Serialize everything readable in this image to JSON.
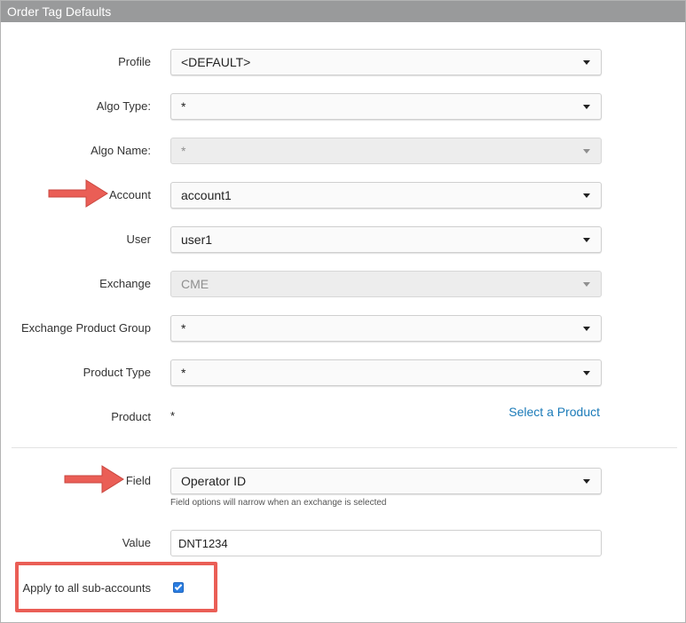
{
  "window": {
    "title": "Order Tag Defaults"
  },
  "form": {
    "profile": {
      "label": "Profile",
      "value": "<DEFAULT>"
    },
    "algo_type": {
      "label": "Algo Type:",
      "value": "*"
    },
    "algo_name": {
      "label": "Algo Name:",
      "value": "*"
    },
    "account": {
      "label": "Account",
      "value": "account1"
    },
    "user": {
      "label": "User",
      "value": "user1"
    },
    "exchange": {
      "label": "Exchange",
      "value": "CME"
    },
    "exchange_product_group": {
      "label": "Exchange Product Group",
      "value": "*"
    },
    "product_type": {
      "label": "Product Type",
      "value": "*"
    },
    "product": {
      "label": "Product",
      "value": "*",
      "link": "Select a Product"
    },
    "field": {
      "label": "Field",
      "value": "Operator ID",
      "hint": "Field options will narrow when an exchange is selected"
    },
    "value": {
      "label": "Value",
      "value": "DNT1234"
    },
    "apply_sub_accounts": {
      "label": "Apply to all sub-accounts",
      "checked": true
    }
  },
  "colors": {
    "titlebar": "#999a9b",
    "link": "#1a7ab8",
    "annotation": "#ea5e56",
    "checkbox": "#2a7de1"
  },
  "icons": [
    "caret-down-icon",
    "checkmark-icon",
    "annotation-arrow-icon"
  ]
}
